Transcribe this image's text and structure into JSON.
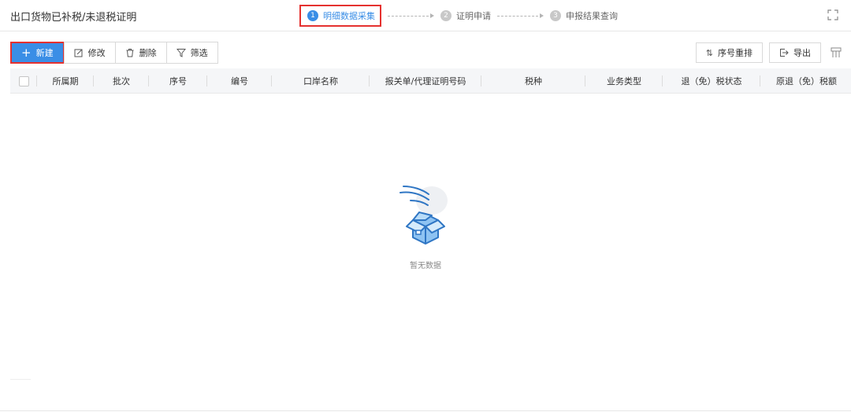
{
  "header": {
    "title": "出口货物已补税/未退税证明",
    "steps": [
      {
        "num": "1",
        "label": "明细数据采集"
      },
      {
        "num": "2",
        "label": "证明申请"
      },
      {
        "num": "3",
        "label": "申报结果查询"
      }
    ]
  },
  "toolbar": {
    "new_label": "新建",
    "edit_label": "修改",
    "delete_label": "删除",
    "filter_label": "筛选",
    "reorder_label": "序号重排",
    "export_label": "导出"
  },
  "table": {
    "columns": [
      "所属期",
      "批次",
      "序号",
      "编号",
      "口岸名称",
      "报关单/代理证明号码",
      "税种",
      "业务类型",
      "退（免）税状态",
      "原退（免）税额"
    ]
  },
  "empty": {
    "text": "暂无数据"
  },
  "colors": {
    "primary": "#3a8ee6",
    "highlight": "#e5312f"
  }
}
